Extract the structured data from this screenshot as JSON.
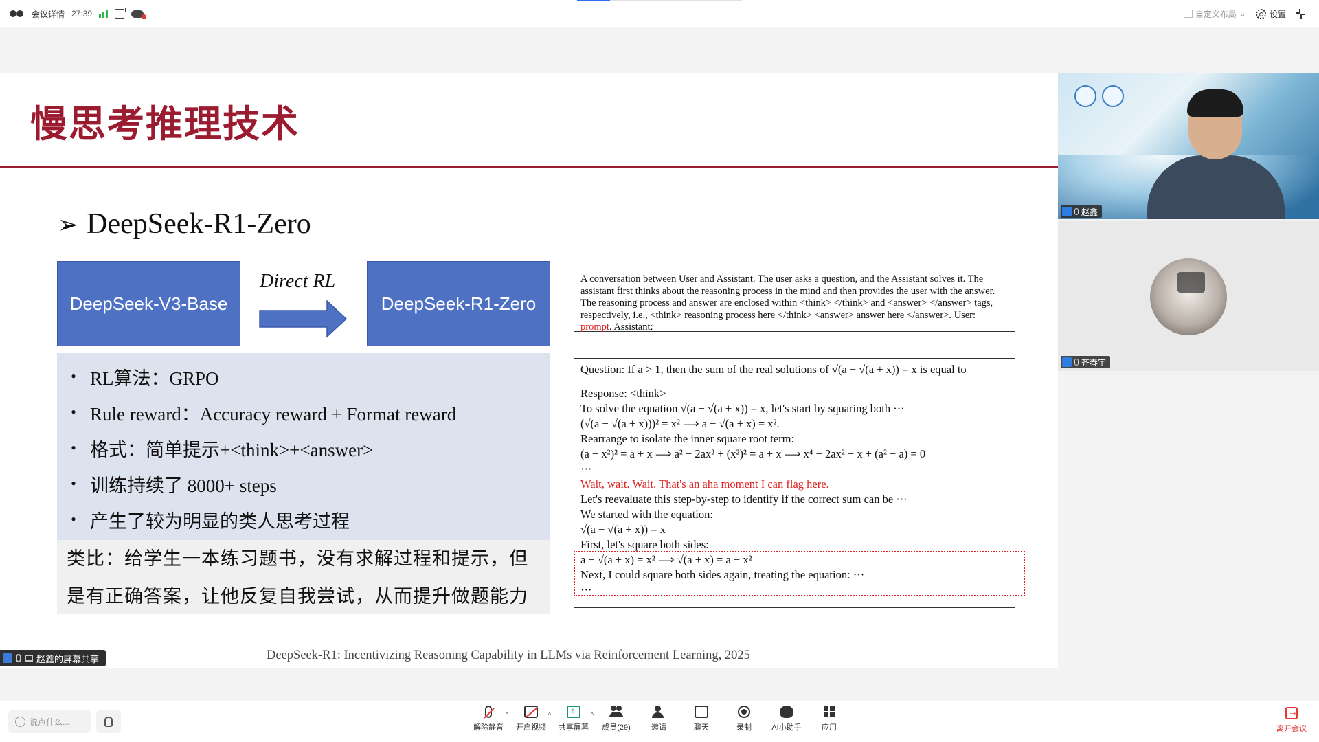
{
  "topbar": {
    "meeting_label": "会议详情",
    "timer": "27:39",
    "layout_label": "自定义布局",
    "settings_label": "设置",
    "progress_fraction": 0.2
  },
  "slide": {
    "title": "慢思考推理技术",
    "subtitle_arrow": "➢",
    "subtitle": "DeepSeek-R1-Zero",
    "box_base": "DeepSeek-V3-Base",
    "direct_rl": "Direct RL",
    "box_zero": "DeepSeek-R1-Zero",
    "bullets": [
      "RL算法：GRPO",
      "Rule reward：Accuracy reward + Format reward",
      "格式：简单提示+<think>+<answer>",
      "训练持续了 8000+ steps",
      "产生了较为明显的类人思考过程"
    ],
    "analogy_line1": "类比：给学生一本练习题书，没有求解过程和提示，但",
    "analogy_line2": "是有正确答案，让他反复自我尝试，从而提升做题能力",
    "system_prompt_main": "A conversation between User and Assistant. The user asks a question, and the Assistant solves it. The assistant first thinks about the reasoning process in the mind and then provides the user with the answer. The reasoning process and answer are enclosed within <think> </think> and <answer> </answer> tags, respectively, i.e., <think> reasoning process here </think> <answer> answer here </answer>. User: ",
    "system_prompt_red": "prompt",
    "system_prompt_end": ". Assistant:",
    "question": "Question: If a > 1, then the sum of the real solutions of √(a − √(a + x)) = x is equal to",
    "response_lines": [
      "Response: <think>",
      "To solve the equation √(a − √(a + x)) = x, let's start by squaring both ···",
      "(√(a − √(a + x)))² = x²  ⟹  a − √(a + x) = x².",
      "Rearrange to isolate the inner square root term:",
      "(a − x²)² = a + x  ⟹  a² − 2ax² + (x²)² = a + x  ⟹  x⁴ − 2ax² − x + (a² − a) = 0",
      "···"
    ],
    "aha_line": "Wait, wait. Wait. That's an aha moment I can flag here.",
    "reevaluate_line": "Let's reevaluate this step-by-step to identify if the correct sum can be ···",
    "after_lines": [
      "We started with the equation:",
      "√(a − √(a + x)) = x",
      "First, let's square both sides:",
      "a − √(a + x) = x²  ⟹  √(a + x) = a − x²",
      "Next, I could square both sides again, treating the equation: ···",
      "···"
    ],
    "citation": "DeepSeek-R1: Incentivizing Reasoning Capability in LLMs via Reinforcement Learning, 2025"
  },
  "share_badge": "赵鑫的屏幕共享",
  "participants": [
    {
      "name": "赵鑫"
    },
    {
      "name": "齐春宇"
    }
  ],
  "bottombar": {
    "chat_placeholder": "说点什么...",
    "tools": [
      {
        "label": "解除静音",
        "icon": "mic-muted-icon"
      },
      {
        "label": "开启视频",
        "icon": "camera-off-icon"
      },
      {
        "label": "共享屏幕",
        "icon": "share-screen-icon"
      },
      {
        "label": "成员(29)",
        "icon": "members-icon"
      },
      {
        "label": "邀请",
        "icon": "invite-icon"
      },
      {
        "label": "聊天",
        "icon": "chat-icon"
      },
      {
        "label": "录制",
        "icon": "record-icon"
      },
      {
        "label": "AI小助手",
        "icon": "ai-assistant-icon"
      },
      {
        "label": "应用",
        "icon": "apps-icon"
      }
    ],
    "leave_label": "离开会议",
    "colors": {
      "leave": "#e53935",
      "share": "#1a9b6b",
      "accent": "#9b1b30"
    }
  }
}
